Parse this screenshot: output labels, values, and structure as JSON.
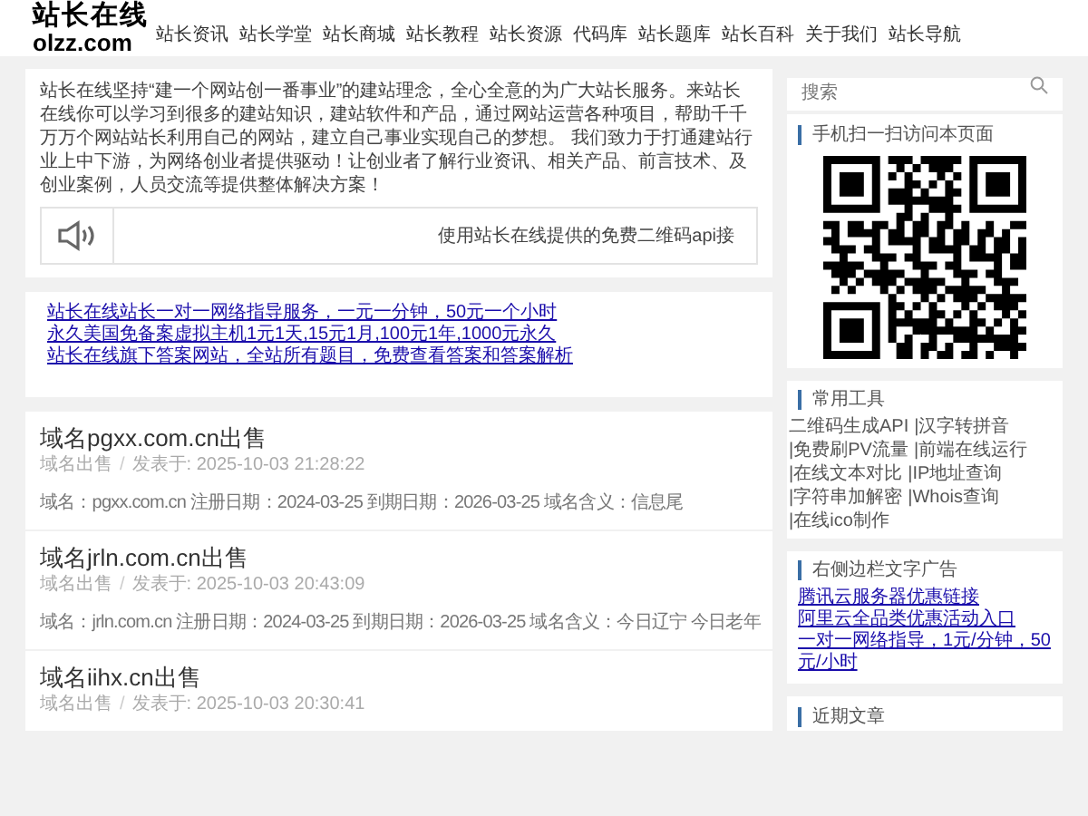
{
  "logo": {
    "title": "站长在线",
    "domain": "olzz.com"
  },
  "nav": [
    "站长资讯",
    "站长学堂",
    "站长商城",
    "站长教程",
    "站长资源",
    "代码库",
    "站长题库",
    "站长百科",
    "关于我们",
    "站长导航"
  ],
  "intro": {
    "text": "站长在线坚持“建一个网站创一番事业”的建站理念，全心全意的为广大站长服务。来站长在线你可以学习到很多的建站知识，建站软件和产品，通过网站运营各种项目，帮助千千万万个网站站长利用自己的网站，建立自己事业实现自己的梦想。 我们致力于打通建站行业上中下游，为网络创业者提供驱动！让创业者了解行业资讯、相关产品、前言技术、及创业案例，人员交流等提供整体解决方案！",
    "notice": "使用站长在线提供的免费二维码api接"
  },
  "ad_links": [
    "站长在线站长一对一网络指导服务，一元一分钟，50元一个小时",
    "永久美国免备案虚拟主机1元1天,15元1月,100元1年,1000元永久",
    "站长在线旗下答案网站，全站所有题目，免费查看答案和答案解析"
  ],
  "posts": [
    {
      "title": "域名pgxx.com.cn出售",
      "category": "域名出售",
      "separator": "/",
      "date": "发表于: 2025-10-03 21:28:22",
      "summary": "域名：pgxx.com.cn 注册日期：2024-03-25 到期日期：2026-03-25 域名含义：信息尾"
    },
    {
      "title": "域名jrln.com.cn出售",
      "category": "域名出售",
      "separator": "/",
      "date": "发表于: 2025-10-03 20:43:09",
      "summary": "域名：jrln.com.cn 注册日期：2024-03-25 到期日期：2026-03-25 域名含义：今日辽宁 今日老年"
    },
    {
      "title": "域名iihx.cn出售",
      "category": "域名出售",
      "separator": "/",
      "date": "发表于: 2025-10-03 20:30:41"
    }
  ],
  "sidebar": {
    "search": {
      "placeholder": "搜索"
    },
    "qr_title": "手机扫一扫访问本页面",
    "tools_title": "常用工具",
    "tools": [
      "二维码生成API",
      "|汉字转拼音",
      "|免费刷PV流量",
      "|前端在线运行",
      "|在线文本对比",
      "|IP地址查询",
      "|字符串加解密",
      "|Whois查询",
      "|在线ico制作"
    ],
    "ads_title": "右侧边栏文字广告",
    "ads": [
      "腾讯云服务器优惠链接",
      "阿里云全品类优惠活动入口",
      "一对一网络指导，1元/分钟，50元/小时"
    ],
    "recent_title": "近期文章"
  }
}
